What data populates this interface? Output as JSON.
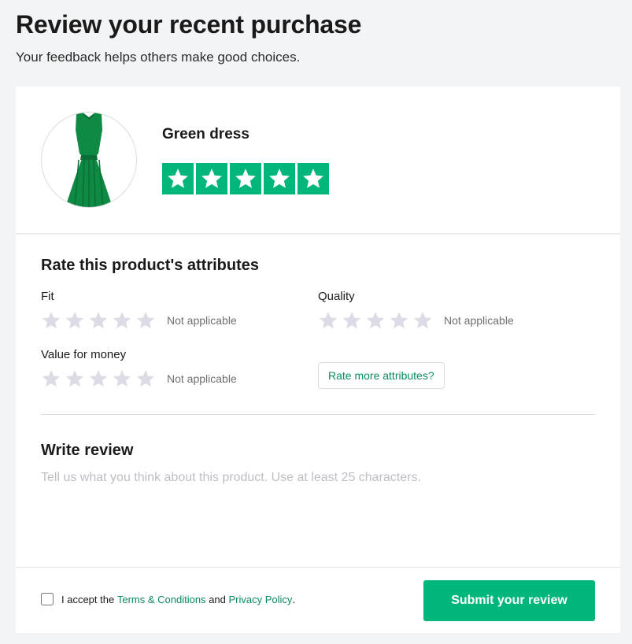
{
  "header": {
    "title": "Review your recent purchase",
    "subtitle": "Your feedback helps others make good choices."
  },
  "product": {
    "name": "Green dress",
    "image_icon": "green-dress-image",
    "rating": 5,
    "rating_max": 5,
    "star_color": "#00b67a"
  },
  "attributes": {
    "heading": "Rate this product's attributes",
    "items": [
      {
        "label": "Fit",
        "rating": 0,
        "status": "Not applicable"
      },
      {
        "label": "Quality",
        "rating": 0,
        "status": "Not applicable"
      },
      {
        "label": "Value for money",
        "rating": 0,
        "status": "Not applicable"
      }
    ],
    "rate_more_label": "Rate more attributes?"
  },
  "review": {
    "heading": "Write review",
    "placeholder": "Tell us what you think about this product. Use at least 25 characters.",
    "value": ""
  },
  "footer": {
    "terms_prefix": "I accept the",
    "terms_link": "Terms & Conditions",
    "terms_and": "and",
    "privacy_link": "Privacy Policy",
    "terms_suffix": ".",
    "accepted": false,
    "submit_label": "Submit your review"
  },
  "colors": {
    "accent": "#00b67a",
    "link": "#0a8a5e",
    "empty_star": "#dcdce6"
  }
}
